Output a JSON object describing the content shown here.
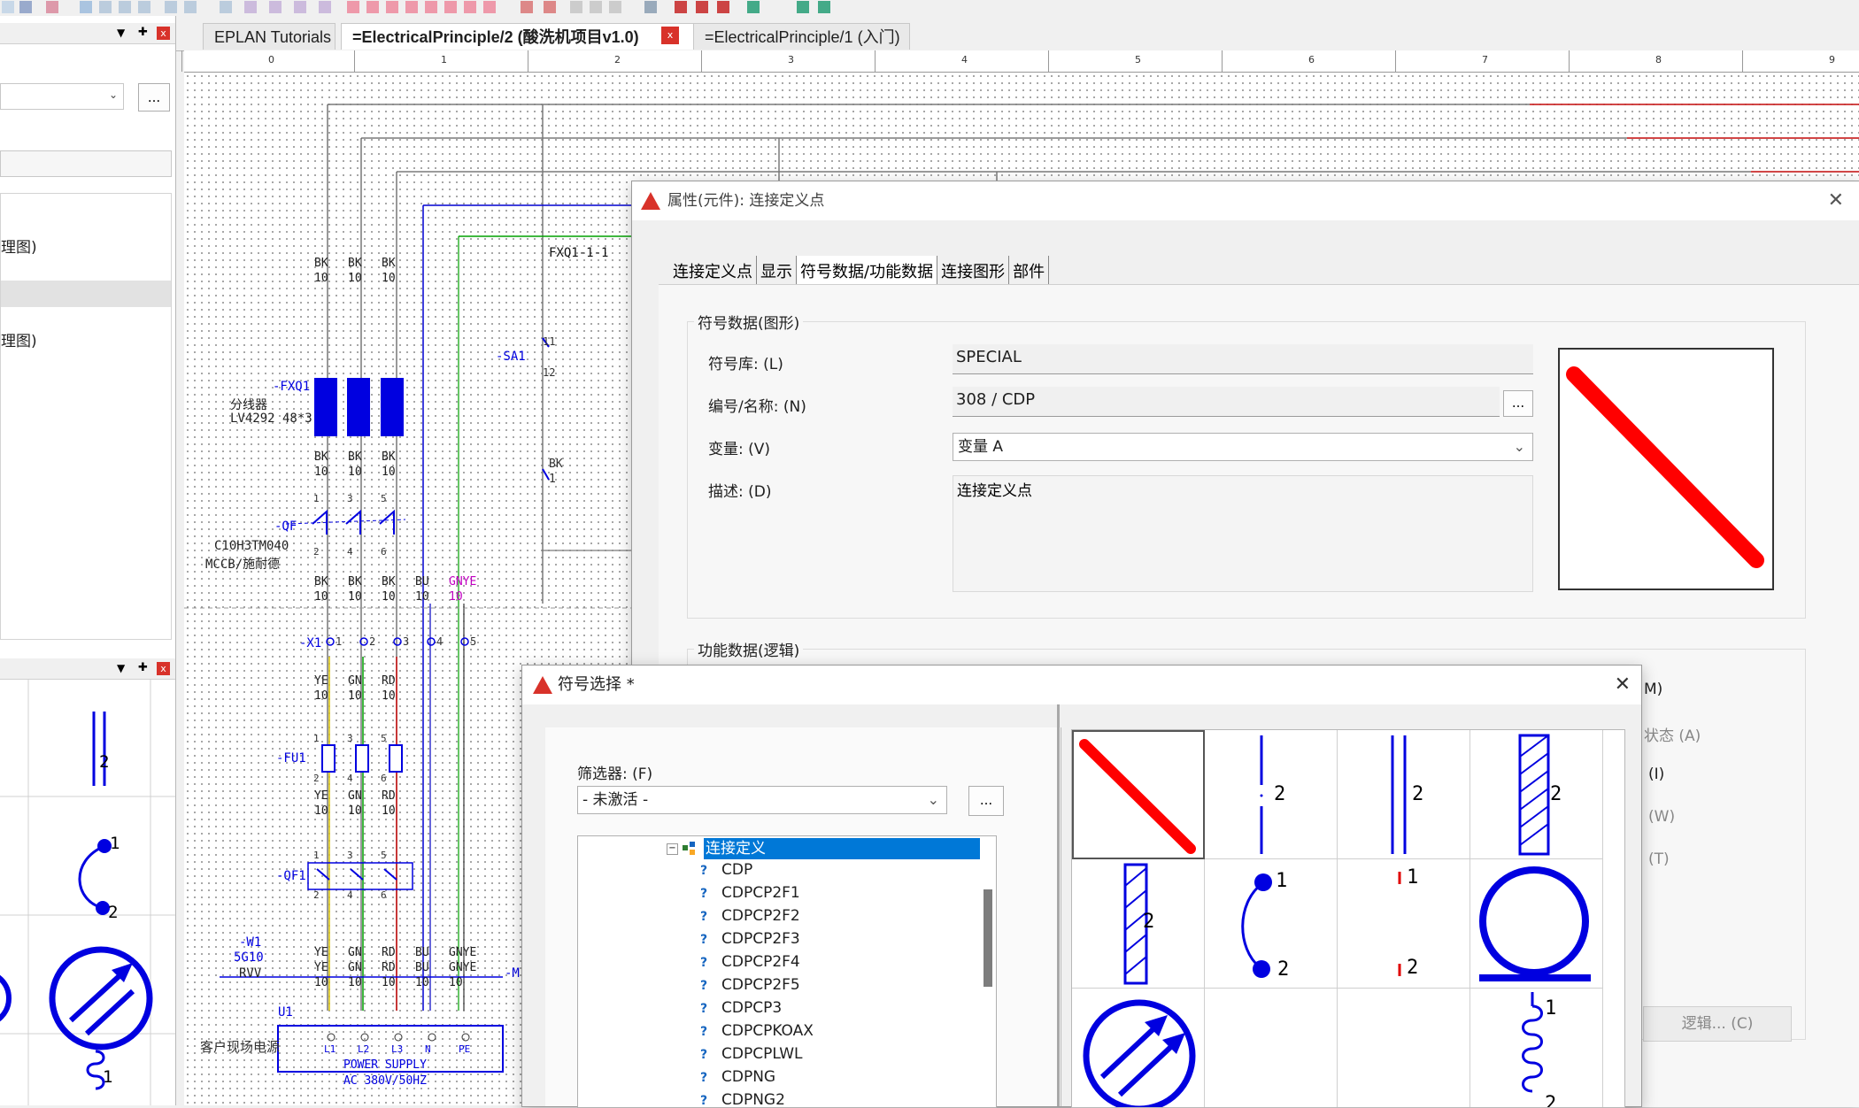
{
  "tabs": [
    {
      "label": "EPLAN Tutorials"
    },
    {
      "label": "=ElectricalPrinciple/2 (酸洗机项目v1.0)"
    },
    {
      "label": "=ElectricalPrinciple/1 (入门)"
    }
  ],
  "left_panel": {
    "tree_items": [
      "理图)",
      "理图)"
    ],
    "more_button": "...",
    "symbol_labels": {
      "two": "2",
      "one": "1",
      "two_b": "2",
      "one_b": "1"
    }
  },
  "ruler": {
    "ticks": [
      "0",
      "1",
      "2",
      "3",
      "4",
      "5",
      "6",
      "7",
      "8",
      "9"
    ]
  },
  "schematic": {
    "fxq1_ref": "FXQ1-1-1",
    "sa1_ref": "-SA1",
    "sa1_pins": [
      "11",
      "12"
    ],
    "wire_bk_1": [
      "BK",
      "1"
    ],
    "fxq1": "-FXQ1",
    "fxq1_desc1": "分线器",
    "fxq1_desc2": "LV4292 48*3",
    "qf": "-QF",
    "qf_desc1": "C10H3TM040",
    "qf_desc2": "MCCB/施耐德",
    "x1": "-X1",
    "fu1": "-FU1",
    "qf1": "-QF1",
    "w1": "-W1",
    "w1_desc1": "5G10",
    "w1_desc2": "RVV",
    "m": "-M",
    "u1": "U1",
    "customer": "客户现场电源",
    "psu1": "POWER SUPPLY",
    "psu2": "AC 380V/50HZ",
    "psu_pins": [
      "L1",
      "L2",
      "L3",
      "N",
      "PE"
    ],
    "wires_top": [
      [
        "BK",
        "10"
      ],
      [
        "BK",
        "10"
      ],
      [
        "BK",
        "10"
      ]
    ],
    "wires_mid": [
      [
        "BK",
        "10"
      ],
      [
        "BK",
        "10"
      ],
      [
        "BK",
        "10"
      ]
    ],
    "wires_qf_out": [
      [
        "BK",
        "10"
      ],
      [
        "BK",
        "10"
      ],
      [
        "BK",
        "10"
      ],
      [
        "BU",
        "10"
      ],
      [
        "GNYE",
        "10"
      ]
    ],
    "wires_x1": [
      [
        "YE",
        "10"
      ],
      [
        "GN",
        "10"
      ],
      [
        "RD",
        "10"
      ]
    ],
    "wires_fu": [
      [
        "YE",
        "10"
      ],
      [
        "GN",
        "10"
      ],
      [
        "RD",
        "10"
      ]
    ],
    "wires_cable": [
      [
        "YE",
        "YE",
        "10"
      ],
      [
        "GN",
        "GN",
        "10"
      ],
      [
        "RD",
        "RD",
        "10"
      ],
      [
        "BU",
        "BU",
        "10"
      ],
      [
        "GNYE",
        "GNYE",
        "10"
      ]
    ],
    "x1_pins": [
      "1",
      "2",
      "3",
      "4",
      "5"
    ],
    "pins_odd": [
      "1",
      "3",
      "5"
    ],
    "pins_even": [
      "2",
      "4",
      "6"
    ]
  },
  "props_dialog": {
    "title": "属性(元件): 连接定义点",
    "tabs": [
      "连接定义点",
      "显示",
      "符号数据/功能数据",
      "连接图形",
      "部件"
    ],
    "group_symbol": "符号数据(图形)",
    "symbol_lib_label": "符号库: (L)",
    "symbol_lib_value": "SPECIAL",
    "number_label": "编号/名称: (N)",
    "number_value": "308 / CDP",
    "number_btn": "...",
    "variant_label": "变量: (V)",
    "variant_value": "变量 A",
    "desc_label": "描述: (D)",
    "desc_value": "连接定义点",
    "group_function": "功能数据(逻辑)",
    "partial_labels": [
      "M)",
      "状态 (A)",
      "(I)",
      "(W)",
      "(T)"
    ],
    "logic_button": "逻辑... (C)"
  },
  "symbol_dialog": {
    "title": "符号选择 *",
    "filter_label": "筛选器: (F)",
    "filter_value": "- 未激活 -",
    "filter_btn": "...",
    "tree_root": "连接定义",
    "tree_items": [
      "CDP",
      "CDPCP2F1",
      "CDPCP2F2",
      "CDPCP2F3",
      "CDPCP2F4",
      "CDPCP2F5",
      "CDPCP3",
      "CDPCPKOAX",
      "CDPCPLWL",
      "CDPNG",
      "CDPNG2"
    ],
    "grid_labels": {
      "c2": "2",
      "c3": "2",
      "c4": "2",
      "c5": "2",
      "c6_1": "1",
      "c6_2": "2",
      "c7_1": "1",
      "c7_2": "2",
      "c12_1": "1",
      "c12_2": "2"
    }
  },
  "colors": {
    "accent_red": "#ff0000",
    "symbol_blue": "#0000e0",
    "selection": "#0078d7"
  }
}
